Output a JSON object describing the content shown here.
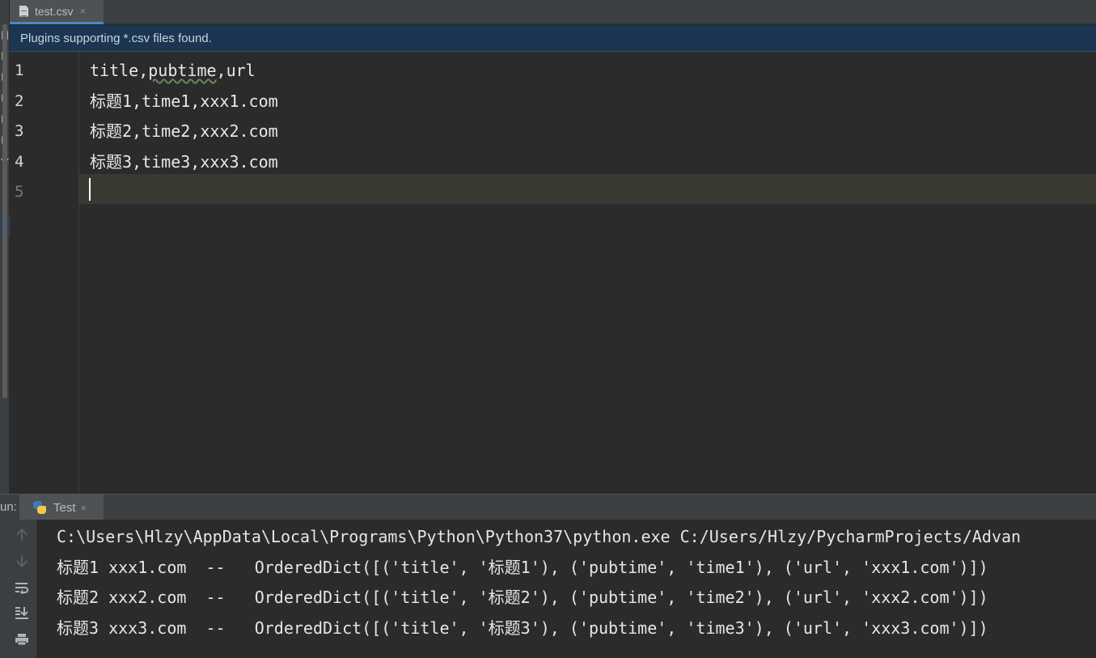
{
  "editor_tab": {
    "label": "test.csv",
    "close": "×"
  },
  "banner": {
    "text": "Plugins supporting *.csv files found."
  },
  "editor": {
    "line_numbers": [
      "1",
      "2",
      "3",
      "4",
      "5"
    ],
    "lines": [
      {
        "pre": "title,",
        "squiggle": "pubtime",
        "post": ",url"
      },
      {
        "pre": "标题1,time1,xxx1.com",
        "squiggle": "",
        "post": ""
      },
      {
        "pre": "标题2,time2,xxx2.com",
        "squiggle": "",
        "post": ""
      },
      {
        "pre": "标题3,time3,xxx3.com",
        "squiggle": "",
        "post": ""
      },
      {
        "pre": "",
        "squiggle": "",
        "post": ""
      }
    ]
  },
  "run_panel": {
    "label": "un:",
    "tab_label": "Test",
    "tab_close": "×",
    "toolbar_icons": [
      "up-arrow-icon",
      "down-arrow-icon",
      "soft-wrap-icon",
      "scroll-to-end-icon",
      "print-icon"
    ]
  },
  "console": {
    "lines": [
      "C:\\Users\\Hlzy\\AppData\\Local\\Programs\\Python\\Python37\\python.exe C:/Users/Hlzy/PycharmProjects/Advan",
      "标题1 xxx1.com  --   OrderedDict([('title', '标题1'), ('pubtime', 'time1'), ('url', 'xxx1.com')])",
      "标题2 xxx2.com  --   OrderedDict([('title', '标题2'), ('pubtime', 'time2'), ('url', 'xxx2.com')])",
      "标题3 xxx3.com  --   OrderedDict([('title', '标题3'), ('pubtime', 'time3'), ('url', 'xxx3.com')])"
    ]
  },
  "colors": {
    "background": "#2b2b2b",
    "toolbar": "#3c3f41",
    "banner": "#1c3552",
    "tab_underline": "#4a88c7",
    "current_line": "#3a3a33"
  }
}
